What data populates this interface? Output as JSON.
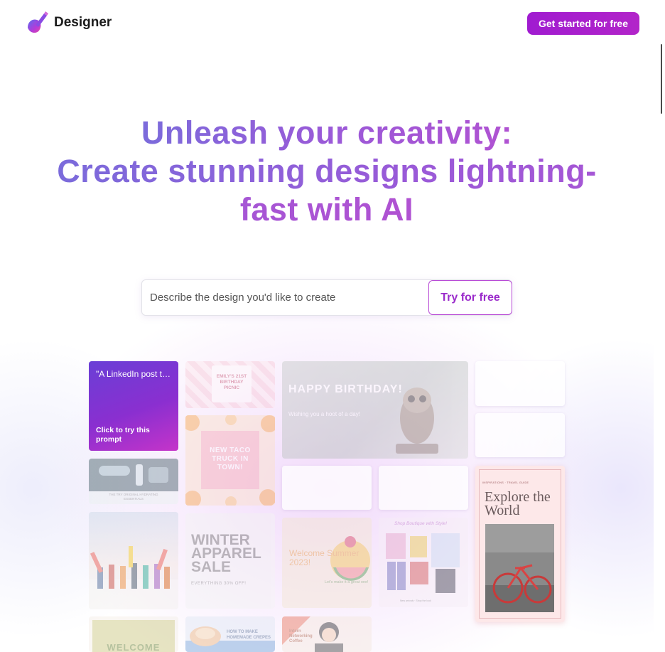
{
  "header": {
    "brand": "Designer",
    "cta_label": "Get started for free"
  },
  "hero": {
    "line1": "Unleash your creativity:",
    "line2": "Create stunning designs lightning-fast with AI"
  },
  "prompt": {
    "placeholder": "Describe the design you'd like to create",
    "button_label": "Try for free"
  },
  "gallery": {
    "prompt_card": {
      "text": "\"A LinkedIn post t…",
      "cta": "Click to try this prompt"
    },
    "picnic": "EMILY'S 21ST BIRTHDAY PICNIC",
    "owl_title": "HAPPY BIRTHDAY!",
    "owl_sub": "Wishing you a hoot of a day!",
    "cosmetics": "THE TRY ORIGINAL HYDRATING ESSENTIALS",
    "taco": "NEW TACO TRUCK IN TOWN!",
    "winter_title": "WINTER APPAREL SALE",
    "winter_sub": "EVERYTHING 30% OFF!",
    "summer_title": "Welcome Summer 2023!",
    "summer_sub": "Let's make it a great one!",
    "clothes_title": "Shop Boutique with Style!",
    "clothes_sub": "New arrivals · Shop the look",
    "explore_tag": "INSPIRATIONS · TRAVEL GUIDE",
    "explore_title": "Explore the World",
    "welcome": "WELCOME",
    "crepes": "HOW TO MAKE HOMEMADE CREPES",
    "coffee": "Intern Networking Coffee"
  },
  "colors": {
    "brand_purple": "#a01bd0",
    "hero_gradient_start": "#7b6bdb",
    "hero_gradient_end": "#b052d2"
  },
  "icons": {
    "logo": "designer-logo-icon"
  }
}
